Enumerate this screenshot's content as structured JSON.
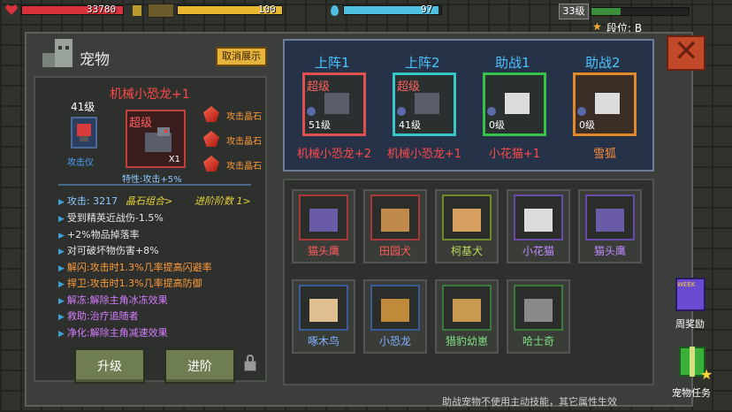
{
  "hud": {
    "hp_value": "33780",
    "energy_value": "100",
    "mana_value": "97",
    "level": "33级",
    "rank_label": "段位: B",
    "colors": {
      "hp": "#d9323a",
      "energy": "#e8b830",
      "mana": "#4fc1e0",
      "xp": "#3a8f3a"
    }
  },
  "window": {
    "title": "宠物",
    "hide_button": "取消展示",
    "close_icon": "close-icon"
  },
  "pet_detail": {
    "name": "机械小恐龙+1",
    "level": "41级",
    "equip_label": "攻击仪",
    "pet_tag": "超级",
    "count": "X1",
    "trait": "特性:攻击+5%",
    "gems": [
      "攻击晶石",
      "攻击晶石",
      "攻击晶石"
    ],
    "attack_label": "攻击: 3217",
    "gem_combo": "晶石组合>",
    "advance_level": "进阶阶数 1>",
    "stats": [
      {
        "text": "受到精英近战伤-1.5%",
        "color": "#e6e6e6"
      },
      {
        "text": "+2%物品掉落率",
        "color": "#e6e6e6"
      },
      {
        "text": "对可破坏物伤害+8%",
        "color": "#e6e6e6"
      },
      {
        "text": "解闪:攻击时1.3%几率提高闪避率",
        "color": "#ff9b3a"
      },
      {
        "text": "捍卫:攻击时1.3%几率提高防御",
        "color": "#ff9b3a"
      },
      {
        "text": "解冻:解除主角冰冻效果",
        "color": "#d57cff"
      },
      {
        "text": "救助:治疗追随者",
        "color": "#d57cff"
      },
      {
        "text": "净化:解除主角减速效果",
        "color": "#d57cff"
      }
    ],
    "upgrade_button": "升级",
    "advance_button": "进阶"
  },
  "team": [
    {
      "slot": "上阵1",
      "tag": "超级",
      "level": "51级",
      "name": "机械小恐龙+2",
      "name_color": "#ff4a4a",
      "border": "#e05050"
    },
    {
      "slot": "上阵2",
      "tag": "超级",
      "level": "41级",
      "name": "机械小恐龙+1",
      "name_color": "#ff4a4a",
      "border": "#36c6c6"
    },
    {
      "slot": "助战1",
      "tag": "",
      "level": "0级",
      "name": "小花猫+1",
      "name_color": "#ff4a4a",
      "border": "#37c24a"
    },
    {
      "slot": "助战2",
      "tag": "",
      "level": "0级",
      "name": "雪狐",
      "name_color": "#ff8c3a",
      "border": "#e08a2a"
    }
  ],
  "pets": [
    {
      "name": "猫头鹰",
      "color": "#ff5a5a",
      "border": "#a83838"
    },
    {
      "name": "田园犬",
      "color": "#ff5a5a",
      "border": "#a83838"
    },
    {
      "name": "柯基犬",
      "color": "#b9d65a",
      "border": "#6f8a2a"
    },
    {
      "name": "小花猫",
      "color": "#c08aff",
      "border": "#6a4aa8"
    },
    {
      "name": "猫头鹰",
      "color": "#c08aff",
      "border": "#6a4aa8"
    },
    {
      "name": "啄木鸟",
      "color": "#7fb0ff",
      "border": "#3a5a98"
    },
    {
      "name": "小恐龙",
      "color": "#7fb0ff",
      "border": "#3a5a98"
    },
    {
      "name": "猎豹幼崽",
      "color": "#7fe07f",
      "border": "#3a7a3a"
    },
    {
      "name": "哈士奇",
      "color": "#7fe07f",
      "border": "#3a7a3a"
    }
  ],
  "footer_note": "助战宠物不使用主动技能，其它属性生效",
  "side": {
    "weekly_reward": "周奖励",
    "pet_task": "宠物任务",
    "week_badge": "WEEK"
  }
}
